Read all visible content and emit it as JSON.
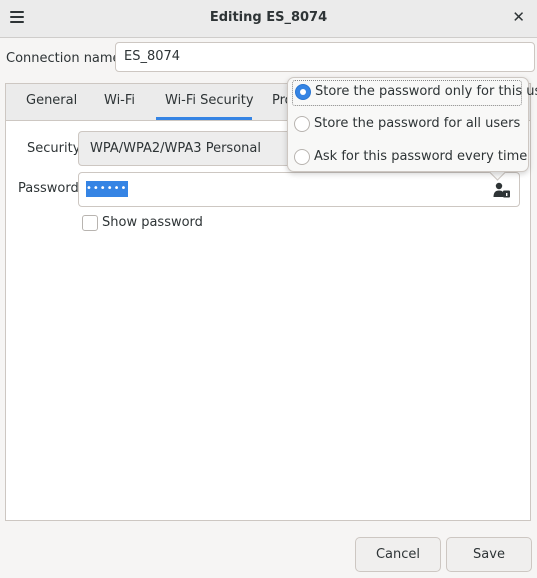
{
  "window": {
    "title": "Editing ES_8074"
  },
  "connection": {
    "label": "Connection name",
    "value": "ES_8074"
  },
  "tabs": [
    {
      "label": "General"
    },
    {
      "label": "Wi-Fi"
    },
    {
      "label": "Wi-Fi Security"
    },
    {
      "label": "Pro"
    }
  ],
  "security": {
    "label": "Security",
    "value": "WPA/WPA2/WPA3 Personal"
  },
  "password": {
    "label": "Password",
    "masked": "••••••••"
  },
  "show_password": {
    "label": "Show password",
    "checked": false
  },
  "popover": {
    "options": [
      {
        "label": "Store the password only for this user",
        "selected": true
      },
      {
        "label": "Store the password for all users",
        "selected": false
      },
      {
        "label": "Ask for this password every time",
        "selected": false
      }
    ]
  },
  "buttons": {
    "cancel": "Cancel",
    "save": "Save"
  },
  "colors": {
    "accent": "#3584e4"
  }
}
